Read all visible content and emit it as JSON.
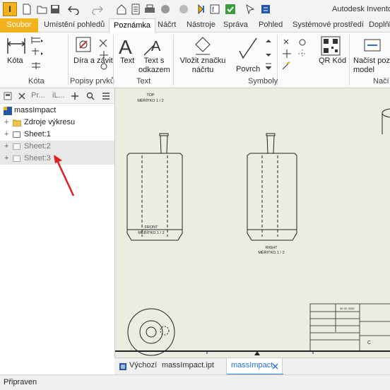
{
  "app": {
    "logo": "I",
    "title": "Autodesk Inventor"
  },
  "quick_access_icons": [
    "new-icon",
    "open-icon",
    "save-icon",
    "undo-icon",
    "redo-icon",
    "home-icon",
    "properties-icon",
    "print-icon",
    "material-icon",
    "appearance-icon",
    "measure-icon",
    "parameters-icon",
    "select-icon"
  ],
  "tabs": [
    "Soubor",
    "Umístění pohledů",
    "Poznámka",
    "Náčrt",
    "Nástroje",
    "Správa",
    "Pohled",
    "Systémové prostředí",
    "Doplňky"
  ],
  "active_tab": "Poznámka",
  "ribbon": {
    "groups": [
      {
        "title": "Kóta",
        "tools": [
          {
            "label": "Kóta",
            "icon": "dimension-icon"
          }
        ]
      },
      {
        "title": "Popisy prvků",
        "tools": [
          {
            "label": "Díra a závit",
            "icon": "hole-thread-icon"
          }
        ]
      },
      {
        "title": "Text",
        "tools": [
          {
            "label": "Text",
            "icon": "text-icon"
          },
          {
            "label": "Text s odkazem",
            "icon": "leader-text-icon"
          }
        ]
      },
      {
        "title": "Symboly",
        "tools": [
          {
            "label": "Vložit značku náčrtu",
            "icon": "sketch-symbol-icon"
          },
          {
            "label": "Povrch",
            "icon": "surface-texture-icon"
          },
          {
            "label": "QR Kód",
            "icon": "qr-code-icon"
          }
        ]
      },
      {
        "title": "Načí",
        "tools": [
          {
            "label": "Načíst pozn model",
            "icon": "retrieve-model-annotations-icon"
          }
        ]
      }
    ]
  },
  "browser": {
    "tabs": [
      "Pr...",
      "iL..."
    ],
    "tree": [
      {
        "label": "massImpact",
        "level": 0,
        "expander": "",
        "icon": "drawing-icon"
      },
      {
        "label": "Zdroje výkresu",
        "level": 1,
        "expander": "+",
        "icon": "folder-icon"
      },
      {
        "label": "Sheet:1",
        "level": 1,
        "expander": "+",
        "icon": "sheet-icon"
      },
      {
        "label": "Sheet:2",
        "level": 1,
        "expander": "+",
        "icon": "sheet-icon"
      },
      {
        "label": "Sheet:3",
        "level": 1,
        "expander": "+",
        "icon": "sheet-icon"
      }
    ]
  },
  "drawing": {
    "view_labels": {
      "top": [
        "TOP",
        "MĚŘÍTKO 1 / 2"
      ],
      "front": [
        "FRONT",
        "MĚŘÍTKO 1 / 2"
      ],
      "right": [
        "RIGHT",
        "MĚŘÍTKO 1 / 2"
      ]
    },
    "title_block": {
      "date": "30 XII 2025",
      "size": "C"
    }
  },
  "document_tabs": [
    "Výchozí",
    "massImpact.ipt",
    "massImpact"
  ],
  "active_document": "massImpact",
  "status": "Připraven",
  "colors": {
    "accent": "#f2b21b",
    "tab_active_underline": "#1e90ff",
    "annotation_arrow": "#e0201f"
  }
}
